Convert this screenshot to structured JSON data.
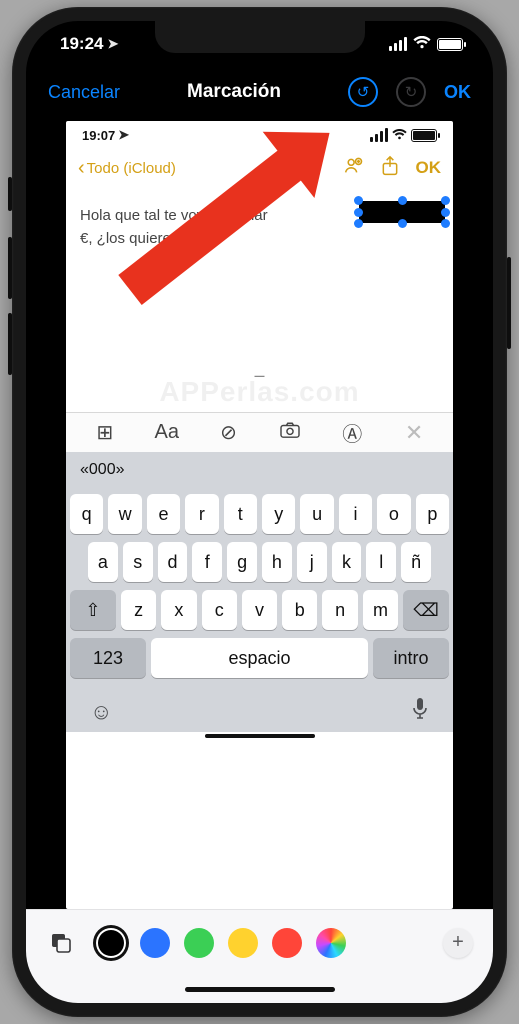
{
  "outer_status": {
    "time": "19:24",
    "loc_glyph": "➤"
  },
  "markup_nav": {
    "cancel": "Cancelar",
    "title": "Marcación",
    "undo_glyph": "↺",
    "redo_glyph": "↻",
    "ok": "OK"
  },
  "inner_status": {
    "time": "19:07",
    "loc_glyph": "➤"
  },
  "notes_nav": {
    "back_chevron": "‹",
    "back_label": "Todo (iCloud)",
    "add_person_glyph": "⊕",
    "share_glyph": "⇪",
    "ok": "OK"
  },
  "note": {
    "line1": "Hola que tal te voy a regalar",
    "line2": "€, ¿los quieres?",
    "watermark": "APPerlas.com",
    "dash": "–"
  },
  "kb_toolbar": {
    "table_glyph": "⊞",
    "aa": "Aa",
    "check_glyph": "⊘",
    "camera_glyph": "📷",
    "pen_glyph": "Ⓐ",
    "close_glyph": "✕"
  },
  "suggestion": {
    "text": "«000»"
  },
  "keys": {
    "r1": [
      "q",
      "w",
      "e",
      "r",
      "t",
      "y",
      "u",
      "i",
      "o",
      "p"
    ],
    "r2": [
      "a",
      "s",
      "d",
      "f",
      "g",
      "h",
      "j",
      "k",
      "l",
      "ñ"
    ],
    "r3": [
      "z",
      "x",
      "c",
      "v",
      "b",
      "n",
      "m"
    ],
    "shift_glyph": "⇧",
    "bksp_glyph": "⌫",
    "num": "123",
    "space": "espacio",
    "intro": "intro",
    "emoji_glyph": "☺",
    "mic_glyph": "🎤"
  },
  "palette": {
    "shapes_glyph": "◪",
    "plus_glyph": "+"
  },
  "colors": {
    "black": "#000000",
    "blue": "#2b74ff",
    "green": "#3bcf55",
    "yellow": "#ffd22e",
    "red": "#ff4539",
    "accent_ios": "#0a84ff",
    "notes_tint": "#d4a016",
    "arrow": "#e8321e"
  }
}
